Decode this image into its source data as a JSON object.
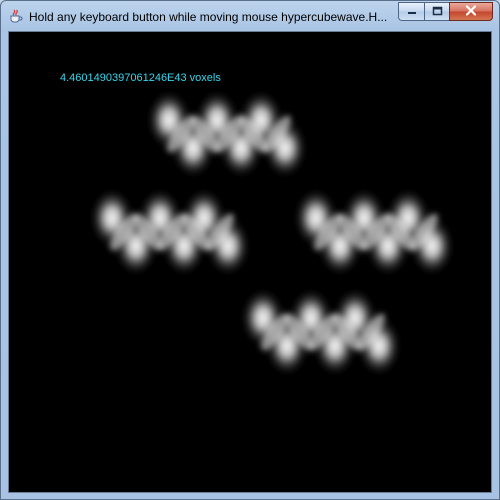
{
  "window": {
    "title": "Hold any keyboard button while moving mouse hypercubewave.H...",
    "icon": "java-coffee-cup-icon",
    "controls": {
      "minimize": "minimize-icon",
      "maximize": "maximize-icon",
      "close": "close-icon"
    }
  },
  "canvas": {
    "background": "#000000",
    "label_color": "#35d7ee",
    "voxel_text": "4.4601490397061246E43 voxels"
  }
}
